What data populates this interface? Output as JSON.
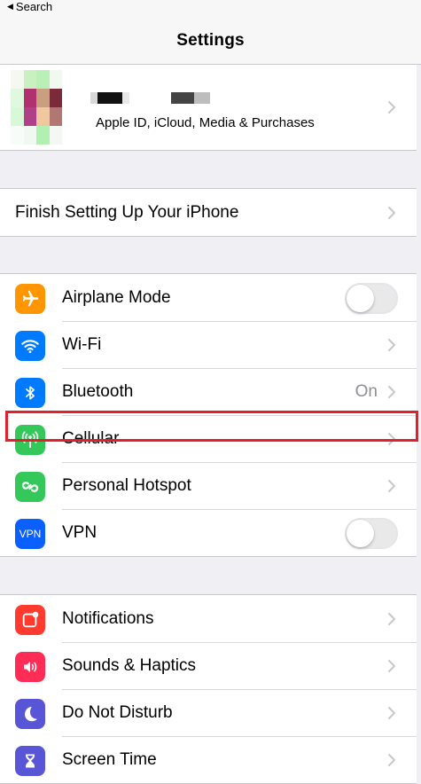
{
  "status_bar": {
    "back_label": "Search"
  },
  "nav": {
    "title": "Settings"
  },
  "profile": {
    "subtitle": "Apple ID, iCloud, Media & Purchases"
  },
  "finish_setup": {
    "label": "Finish Setting Up Your iPhone"
  },
  "connectivity": [
    {
      "label": "Airplane Mode",
      "icon": "airplane-icon",
      "color": "#ff9500",
      "control": "toggle",
      "on": false
    },
    {
      "label": "Wi-Fi",
      "icon": "wifi-icon",
      "color": "#007aff",
      "control": "chevron"
    },
    {
      "label": "Bluetooth",
      "icon": "bluetooth-icon",
      "color": "#007aff",
      "control": "chevron",
      "detail": "On"
    },
    {
      "label": "Cellular",
      "icon": "antenna-icon",
      "color": "#34c759",
      "control": "chevron",
      "highlighted": true
    },
    {
      "label": "Personal Hotspot",
      "icon": "hotspot-icon",
      "color": "#34c759",
      "control": "chevron"
    },
    {
      "label": "VPN",
      "icon": "vpn-icon",
      "icon_text": "VPN",
      "color": "#0a60ff",
      "control": "toggle",
      "on": false
    }
  ],
  "notifications_group": [
    {
      "label": "Notifications",
      "icon": "notifications-icon",
      "color": "#ff3b30"
    },
    {
      "label": "Sounds & Haptics",
      "icon": "speaker-icon",
      "color": "#ff2d55"
    },
    {
      "label": "Do Not Disturb",
      "icon": "moon-icon",
      "color": "#5856d6"
    },
    {
      "label": "Screen Time",
      "icon": "hourglass-icon",
      "color": "#5856d6"
    }
  ],
  "highlight_color": "#e0202a"
}
